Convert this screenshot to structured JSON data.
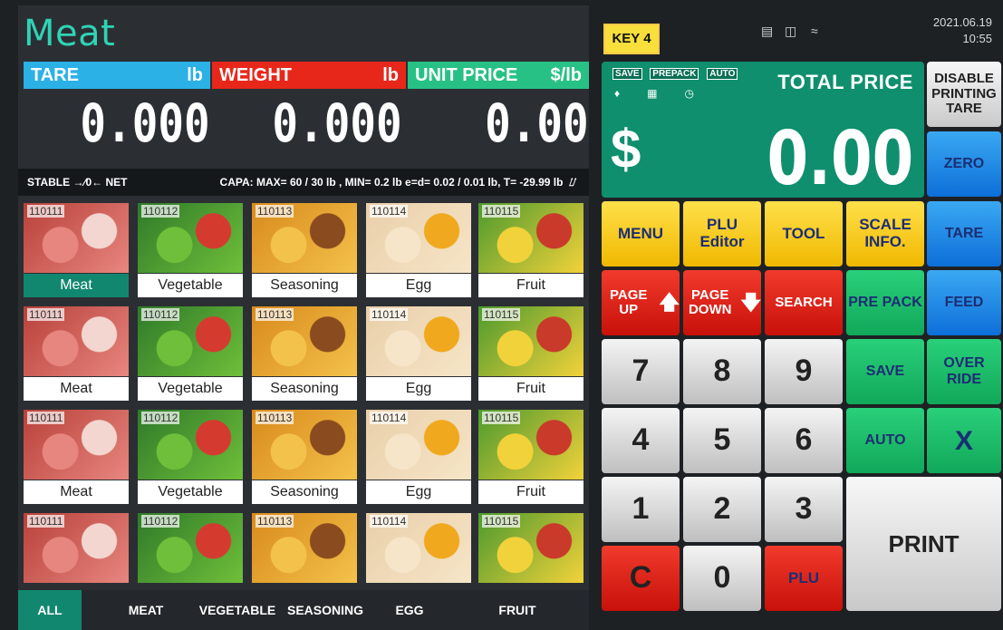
{
  "category_title": "Meat",
  "display": {
    "tare_label": "TARE",
    "tare_unit": "lb",
    "tare_value": "0.000",
    "weight_label": "WEIGHT",
    "weight_unit": "lb",
    "weight_value": "0.000",
    "unit_price_label": "UNIT PRICE",
    "unit_price_unit": "$/lb",
    "unit_price_value": "0.00"
  },
  "status_bar": {
    "left": "STABLE →⁄0← NET",
    "capacity": "CAPA: MAX= 60 / 30 lb , MIN= 0.2 lb e=d= 0.02 / 0.01 lb, T= -29.99 lb"
  },
  "products": [
    {
      "code": "110111",
      "name": "Meat"
    },
    {
      "code": "110112",
      "name": "Vegetable"
    },
    {
      "code": "110113",
      "name": "Seasoning"
    },
    {
      "code": "110114",
      "name": "Egg"
    },
    {
      "code": "110115",
      "name": "Fruit"
    }
  ],
  "tabs": [
    "ALL",
    "MEAT",
    "VEGETABLE",
    "SEASONING",
    "EGG",
    "FRUIT"
  ],
  "key_indicator": "KEY 4",
  "datetime": {
    "date": "2021.06.19",
    "time": "10:55"
  },
  "total_price": {
    "title": "TOTAL PRICE",
    "currency": "$",
    "amount": "0.00",
    "flags": [
      "SAVE",
      "PREPACK",
      "AUTO"
    ]
  },
  "buttons": {
    "disable_printing_tare": "DISABLE PRINTING TARE",
    "zero": "ZERO",
    "menu": "MENU",
    "plu_editor": "PLU Editor",
    "tool": "TOOL",
    "scale_info": "SCALE INFO.",
    "tare": "TARE",
    "page_up": "PAGE UP",
    "page_down": "PAGE DOWN",
    "search": "SEARCH",
    "pre_pack": "PRE PACK",
    "feed": "FEED",
    "save": "SAVE",
    "override": "OVER RIDE",
    "auto": "AUTO",
    "x": "X",
    "print": "PRINT",
    "clear": "C",
    "plu": "PLU",
    "keys": [
      "7",
      "8",
      "9",
      "4",
      "5",
      "6",
      "1",
      "2",
      "3",
      "0"
    ]
  },
  "colors": {
    "accent_teal": "#2fd3b5",
    "total_green": "#0f8f6e",
    "tare_blue": "#2bb1e6",
    "weight_red": "#e8271b",
    "unit_green": "#28c185"
  }
}
